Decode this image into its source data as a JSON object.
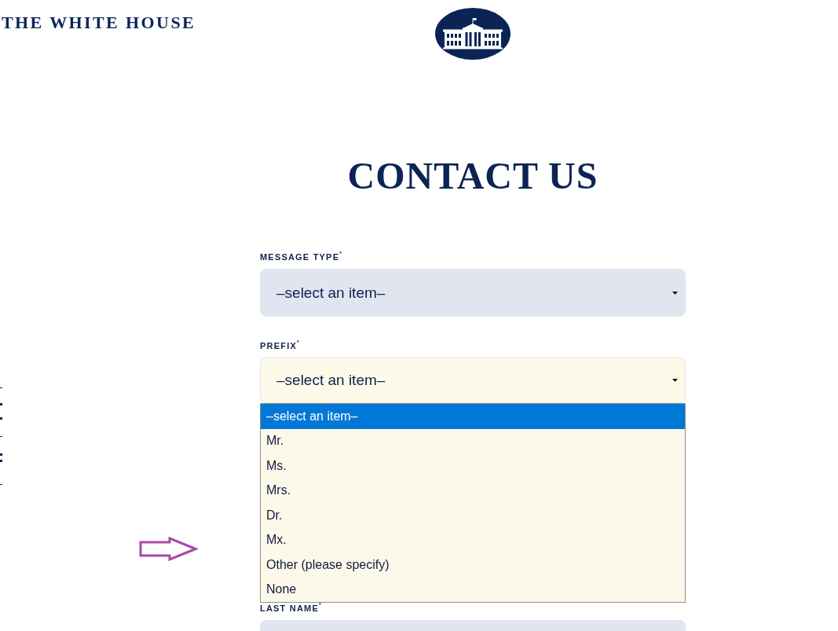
{
  "header": {
    "site_name": "THE WHITE HOUSE"
  },
  "page_title": "CONTACT US",
  "form": {
    "fields": [
      {
        "kind": "select",
        "label": "MESSAGE TYPE$^{*}$",
        "value": "–select an item–",
        "expanded": false
      },
      {
        "kind": "select",
        "label": "PREFIX$^{*}$",
        "value": "–select an item–",
        "expanded": true,
        "options": [
          {
            "label": "–select an item–",
            "selected": true
          },
          {
            "label": "Mr.",
            "selected": false
          },
          {
            "label": "Ms.",
            "selected": false
          },
          {
            "label": "Mrs.",
            "selected": false
          },
          {
            "label": "Dr.",
            "selected": false
          },
          {
            "label": "Mx.",
            "selected": false
          },
          {
            "label": "Other (please specify)",
            "selected": false
          },
          {
            "label": "None",
            "selected": false
          }
        ]
      },
      {
        "kind": "text",
        "label": "LAST NAME$^{*}$"
      }
    ]
  }
}
